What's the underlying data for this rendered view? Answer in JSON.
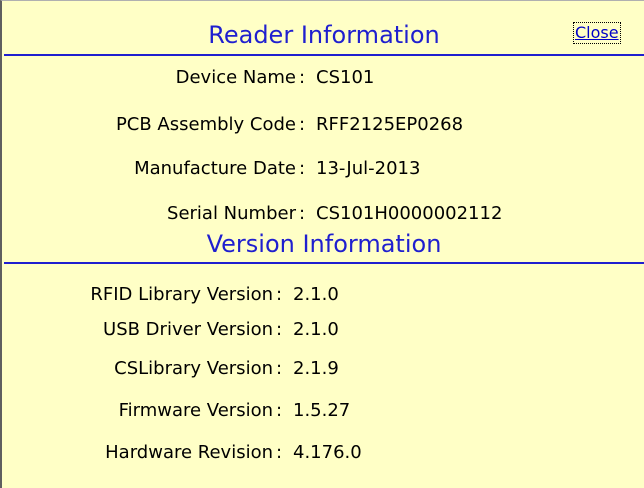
{
  "reader": {
    "title": "Reader Information",
    "close_label": "Close",
    "items": [
      {
        "label": "Device Name",
        "value": "CS101"
      },
      {
        "label": "PCB Assembly Code",
        "value": "RFF2125EP0268"
      },
      {
        "label": "Manufacture Date",
        "value": "13-Jul-2013"
      },
      {
        "label": "Serial Number",
        "value": "CS101H0000002112"
      }
    ]
  },
  "version": {
    "title": "Version Information",
    "items": [
      {
        "label": "RFID Library Version",
        "value": "2.1.0"
      },
      {
        "label": "USB Driver Version",
        "value": "2.1.0"
      },
      {
        "label": "CSLibrary Version",
        "value": "2.1.9"
      },
      {
        "label": "Firmware Version",
        "value": "1.5.27"
      },
      {
        "label": "Hardware Revision",
        "value": "4.176.0"
      }
    ]
  },
  "separator": ":",
  "colors": {
    "background": "#ffffc6",
    "heading": "#1f1fcf",
    "link": "#0000c8"
  }
}
